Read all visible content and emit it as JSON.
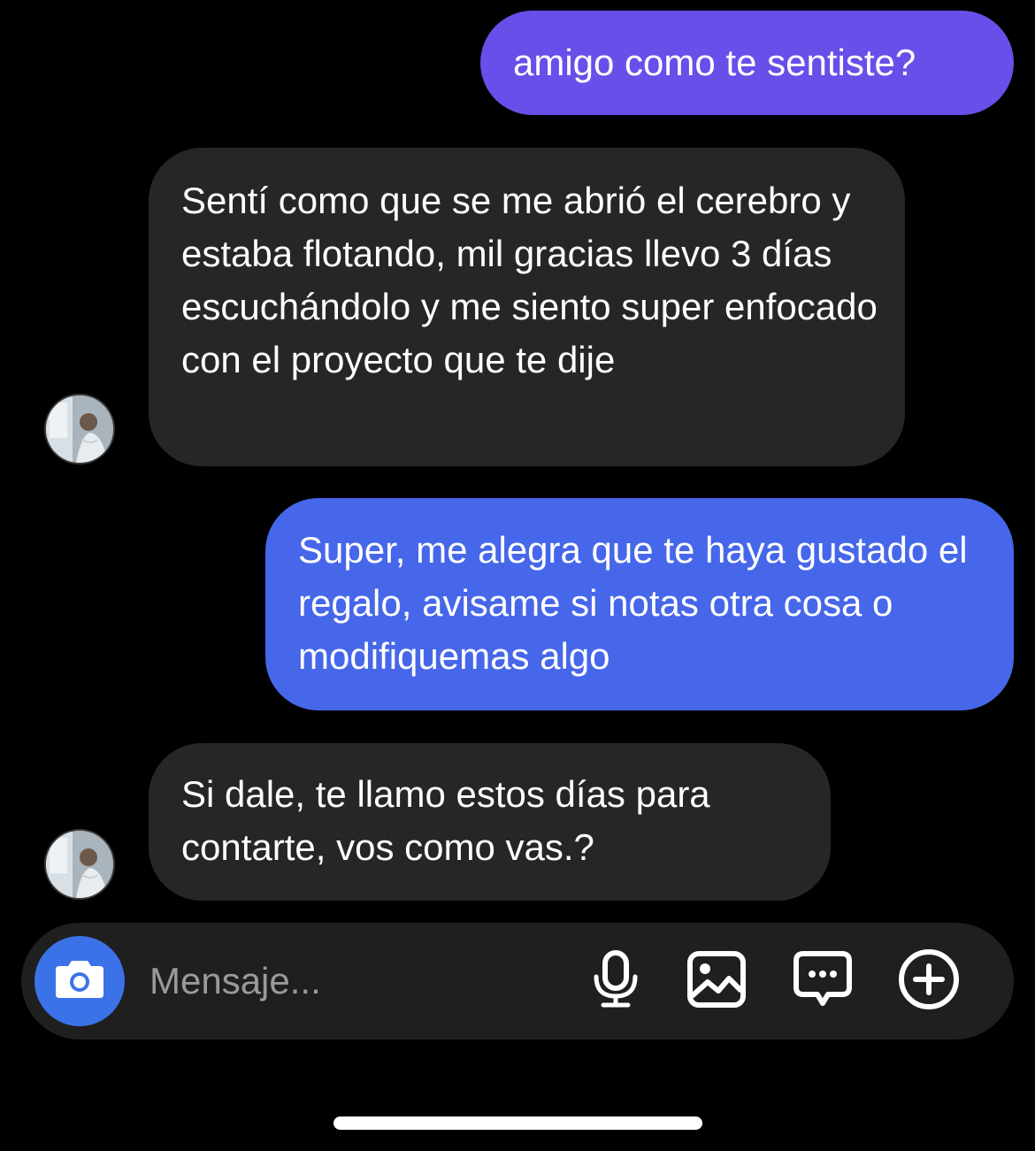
{
  "conversation": {
    "messages": [
      {
        "direction": "outgoing",
        "text": "amigo como te sentiste?"
      },
      {
        "direction": "incoming",
        "text": "Sentí como que se me abrió el cerebro y estaba flotando, mil gracias llevo 3 días escuchándolo y me siento super enfocado con el proyecto que te dije"
      },
      {
        "direction": "outgoing",
        "text": "Super, me alegra que te haya gustado el regalo, avisame si notas otra cosa o modifiquemas algo"
      },
      {
        "direction": "incoming",
        "text": "Si dale, te llamo estos días para contarte, vos como vas.?"
      }
    ]
  },
  "composer": {
    "placeholder": "Mensaje...",
    "value": "",
    "icons": {
      "camera": "camera-icon",
      "mic": "microphone-icon",
      "image": "image-icon",
      "sticker": "chat-bubble-icon",
      "plus": "plus-circle-icon"
    }
  },
  "colors": {
    "background": "#000000",
    "outgoing_1": "#6a4ee9",
    "outgoing_2": "#4667ea",
    "incoming": "#262626",
    "composer": "#1f1f1f",
    "camera_button": "#3b72e8"
  }
}
